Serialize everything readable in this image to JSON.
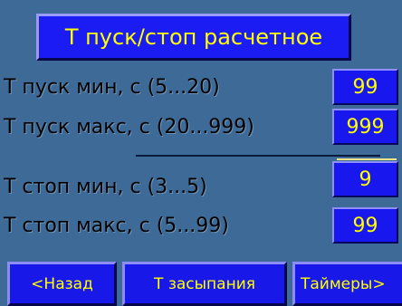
{
  "header": {
    "title": "Т пуск/стоп расчетное"
  },
  "params": [
    {
      "label": "Т пуск мин, с (5...20)",
      "value": "99"
    },
    {
      "label": "Т пуск макс, с (20...999)",
      "value": "999"
    },
    {
      "label": "Т стоп мин, с (3...5)",
      "value": "9"
    },
    {
      "label": "Т стоп макс, с (5...99)",
      "value": "99"
    }
  ],
  "nav": {
    "back_label": "<Назад",
    "sleep_label": "Т засыпания",
    "timers_label": "Таймеры>"
  },
  "colors": {
    "background": "#3d6a97",
    "button": "#1818ee",
    "text_on_button": "#ffff00",
    "label_text": "#000000"
  }
}
